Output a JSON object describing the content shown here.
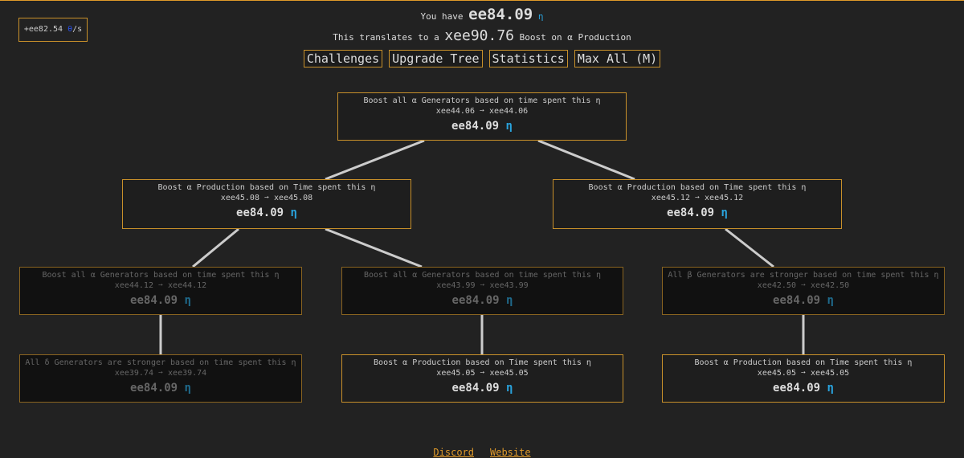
{
  "rate": {
    "value": "+ee82.54",
    "icon": "θ",
    "suffix": "/s"
  },
  "header": {
    "you_have": "You have",
    "amount": "ee84.09",
    "eta": "η",
    "translates": "This translates to a",
    "boost": "xee90.76",
    "boost_suffix": "Boost on α Production"
  },
  "buttons": [
    "Challenges",
    "Upgrade Tree",
    "Statistics",
    "Max All (M)"
  ],
  "nodes": [
    {
      "title": "Boost all α Generators based on time spent this η",
      "effect": "xee44.06 ➙ xee44.06",
      "cost": "ee84.09",
      "eta": "η"
    },
    {
      "title": "Boost α Production based on Time spent this η",
      "effect": "xee45.08 ➙ xee45.08",
      "cost": "ee84.09",
      "eta": "η"
    },
    {
      "title": "Boost α Production based on Time spent this η",
      "effect": "xee45.12 ➙ xee45.12",
      "cost": "ee84.09",
      "eta": "η"
    },
    {
      "title": "Boost all α Generators based on time spent this η",
      "effect": "xee44.12 ➙ xee44.12",
      "cost": "ee84.09",
      "eta": "η"
    },
    {
      "title": "Boost all α Generators based on time spent this η",
      "effect": "xee43.99 ➙ xee43.99",
      "cost": "ee84.09",
      "eta": "η"
    },
    {
      "title": "All β Generators are stronger based on time spent this η",
      "effect": "xee42.50 ➙ xee42.50",
      "cost": "ee84.09",
      "eta": "η"
    },
    {
      "title": "All δ Generators are stronger based on time spent this η",
      "effect": "xee39.74 ➙ xee39.74",
      "cost": "ee84.09",
      "eta": "η"
    },
    {
      "title": "Boost α Production based on Time spent this η",
      "effect": "xee45.05 ➙ xee45.05",
      "cost": "ee84.09",
      "eta": "η"
    },
    {
      "title": "Boost α Production based on Time spent this η",
      "effect": "xee45.05 ➙ xee45.05",
      "cost": "ee84.09",
      "eta": "η"
    }
  ],
  "footer": {
    "discord": "Discord",
    "website": "Website"
  }
}
